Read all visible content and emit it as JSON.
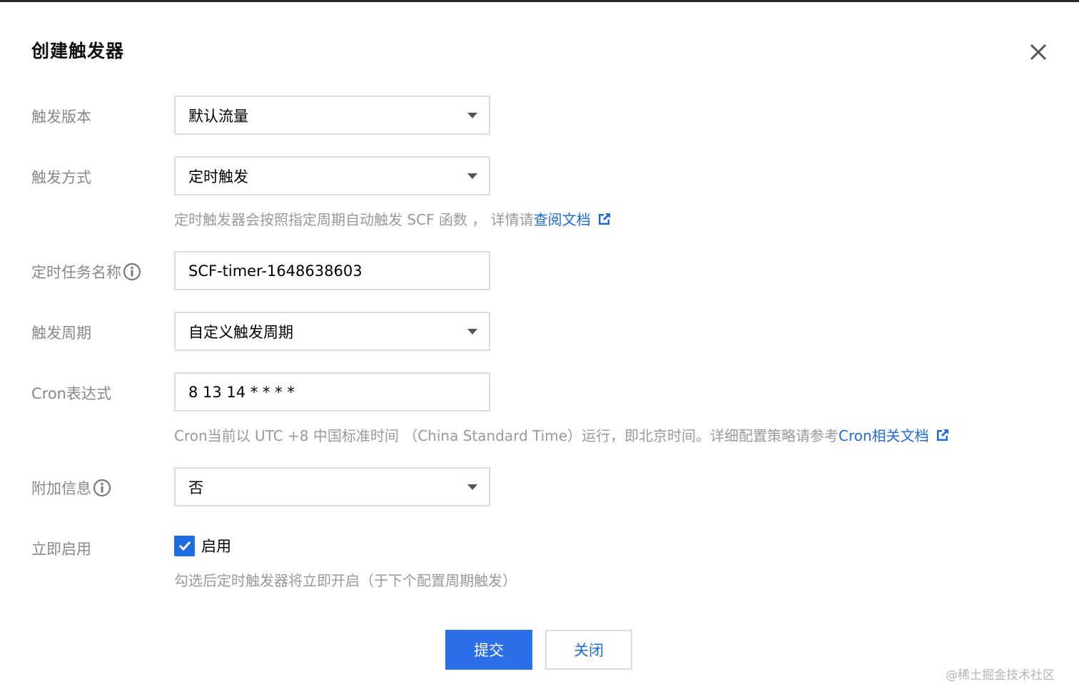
{
  "dialog": {
    "title": "创建触发器"
  },
  "form": {
    "trigger_version": {
      "label": "触发版本",
      "value": "默认流量"
    },
    "trigger_method": {
      "label": "触发方式",
      "value": "定时触发"
    },
    "trigger_method_hint": {
      "text": "定时触发器会按照指定周期自动触发 SCF 函数 ， 详情请",
      "link": "查阅文档"
    },
    "task_name": {
      "label": "定时任务名称",
      "value": "SCF-timer-1648638603"
    },
    "trigger_cycle": {
      "label": "触发周期",
      "value": "自定义触发周期"
    },
    "cron": {
      "label": "Cron表达式",
      "value": "8 13 14 * * * *"
    },
    "cron_hint": {
      "text": "Cron当前以 UTC +8 中国标准时间 （China Standard Time）运行，即北京时间。详细配置策略请参考",
      "link": "Cron相关文档"
    },
    "extra_info": {
      "label": "附加信息",
      "value": "否"
    },
    "enable_now": {
      "label": "立即启用",
      "checkbox_label": "启用",
      "checked": true
    },
    "enable_hint": "勾选后定时触发器将立即开启（于下个配置周期触发）"
  },
  "buttons": {
    "submit": "提交",
    "close": "关闭"
  },
  "watermark": "@稀土掘金技术社区",
  "colors": {
    "primary": "#2d6fe8",
    "link": "#1f6be0",
    "label": "#888888",
    "hint": "#999999",
    "border": "#dcdcdc"
  },
  "icons": {
    "close": "close-icon",
    "dropdown": "caret-down-icon",
    "info": "info-icon",
    "external_link": "external-link-icon",
    "check": "check-icon"
  }
}
